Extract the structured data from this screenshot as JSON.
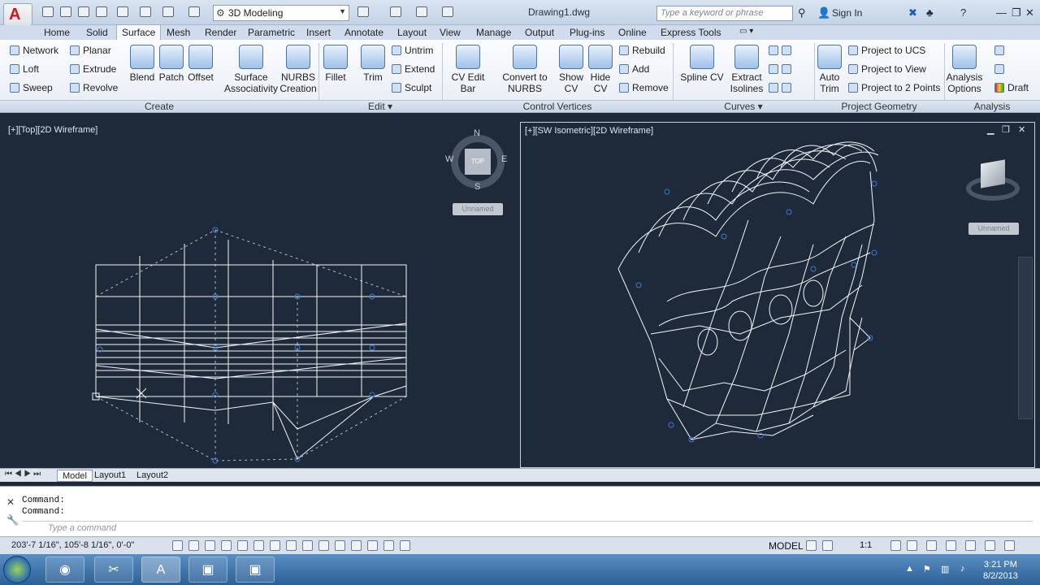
{
  "title": {
    "workspace": "3D Modeling",
    "document": "Drawing1.dwg",
    "search_placeholder": "Type a keyword or phrase",
    "signin": "Sign In"
  },
  "tabs": [
    "Home",
    "Solid",
    "Surface",
    "Mesh",
    "Render",
    "Parametric",
    "Insert",
    "Annotate",
    "Layout",
    "View",
    "Manage",
    "Output",
    "Plug-ins",
    "Online",
    "Express Tools"
  ],
  "active_tab": "Surface",
  "ribbon": {
    "create": {
      "label": "Create",
      "network": "Network",
      "planar": "Planar",
      "loft": "Loft",
      "extrude": "Extrude",
      "sweep": "Sweep",
      "revolve": "Revolve",
      "blend": "Blend",
      "patch": "Patch",
      "offset": "Offset",
      "surface_assoc": "Surface",
      "surface_assoc2": "Associativity",
      "nurbs": "NURBS",
      "nurbs2": "Creation"
    },
    "edit": {
      "label": "Edit",
      "fillet": "Fillet",
      "trim": "Trim",
      "untrim": "Untrim",
      "extend": "Extend",
      "sculpt": "Sculpt"
    },
    "control_vertices": {
      "label": "Control Vertices",
      "cv_edit_bar": "CV Edit Bar",
      "convert": "Convert to",
      "convert2": "NURBS",
      "show_cv": "Show",
      "show_cv2": "CV",
      "hide_cv": "Hide",
      "hide_cv2": "CV",
      "rebuild": "Rebuild",
      "add": "Add",
      "remove": "Remove"
    },
    "curves": {
      "label": "Curves",
      "spline_cv": "Spline CV",
      "extract": "Extract",
      "extract2": "Isolines"
    },
    "project_geometry": {
      "label": "Project Geometry",
      "auto_trim": "Auto",
      "auto_trim2": "Trim",
      "to_ucs": "Project to UCS",
      "to_view": "Project to View",
      "to_2points": "Project to 2 Points"
    },
    "analysis": {
      "label": "Analysis",
      "options": "Analysis",
      "options2": "Options",
      "draft": "Draft"
    }
  },
  "viewport_left": {
    "label": "[+][Top][2D Wireframe]",
    "compass": {
      "n": "N",
      "s": "S",
      "e": "E",
      "w": "W",
      "top": "TOP"
    },
    "ucs_name": "Unnamed"
  },
  "viewport_right": {
    "label": "[+][SW Isometric][2D Wireframe]",
    "ucs_name": "Unnamed"
  },
  "layout_tabs": [
    "Model",
    "Layout1",
    "Layout2"
  ],
  "command": {
    "line1": "Command:",
    "line2": "Command:",
    "input_placeholder": "Type a command"
  },
  "status": {
    "coords": "203'-7 1/16\", 105'-8 1/16\", 0'-0\"",
    "model": "MODEL",
    "scale": "1:1"
  },
  "clock": {
    "time": "3:21 PM",
    "date": "8/2/2013"
  },
  "colors": {
    "viewport_bg": "#1e2a3a",
    "wire": "#f4f6f8",
    "accent": "#3a7bd5"
  }
}
